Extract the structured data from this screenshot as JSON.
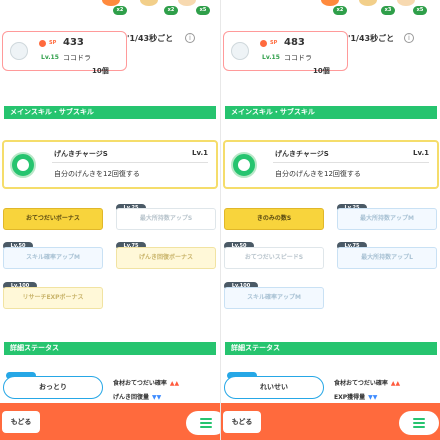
{
  "colors": {
    "accent_green": "#26c46f",
    "accent_orange": "#ff6a3d",
    "chip_active": "#f8d43c",
    "nature_blue": "#26a7e6"
  },
  "panels": [
    {
      "berries": {
        "badges": [
          "x2",
          "x2",
          "x5"
        ]
      },
      "info": {
        "sp_label": "SP",
        "sp_value": "433",
        "level_label": "Lv.15",
        "name": "ココドラ",
        "side_text": "'1/43秒ごと",
        "under_text": "10個"
      },
      "main_skill_header": "メインスキル・サブスキル",
      "main_skill": {
        "name": "げんきチャージS",
        "level": "Lv.1",
        "description": "自分のげんきを12回復する"
      },
      "sub_skills": [
        {
          "level": "Lv.10",
          "name": "おてつだいボーナス"
        },
        {
          "level": "Lv.25",
          "name": "最大所持数アップS"
        },
        {
          "level": "Lv.50",
          "name": "スキル確率アップM"
        },
        {
          "level": "Lv.75",
          "name": "げんき回復ボーナス"
        },
        {
          "level": "Lv.100",
          "name": "リサーチEXPボーナス"
        }
      ],
      "stats_header": "詳細ステータス",
      "nature": "おっとり",
      "stat_up": "食材おてつだい確率",
      "stat_down": "げんき回復量",
      "back_label": "もどる"
    },
    {
      "berries": {
        "badges": [
          "x2",
          "x3",
          "x5"
        ]
      },
      "info": {
        "sp_label": "SP",
        "sp_value": "483",
        "level_label": "Lv.15",
        "name": "ココドラ",
        "side_text": "'1/43秒ごと",
        "under_text": "10個"
      },
      "main_skill_header": "メインスキル・サブスキル",
      "main_skill": {
        "name": "げんきチャージS",
        "level": "Lv.1",
        "description": "自分のげんきを12回復する"
      },
      "sub_skills": [
        {
          "level": "Lv.10",
          "name": "きのみの数S"
        },
        {
          "level": "Lv.25",
          "name": "最大所持数アップM"
        },
        {
          "level": "Lv.50",
          "name": "おてつだいスピードS"
        },
        {
          "level": "Lv.75",
          "name": "最大所持数アップL"
        },
        {
          "level": "Lv.100",
          "name": "スキル確率アップM"
        }
      ],
      "stats_header": "詳細ステータス",
      "nature": "れいせい",
      "stat_up": "食材おてつだい確率",
      "stat_down": "EXP獲得量",
      "back_label": "もどる"
    }
  ]
}
